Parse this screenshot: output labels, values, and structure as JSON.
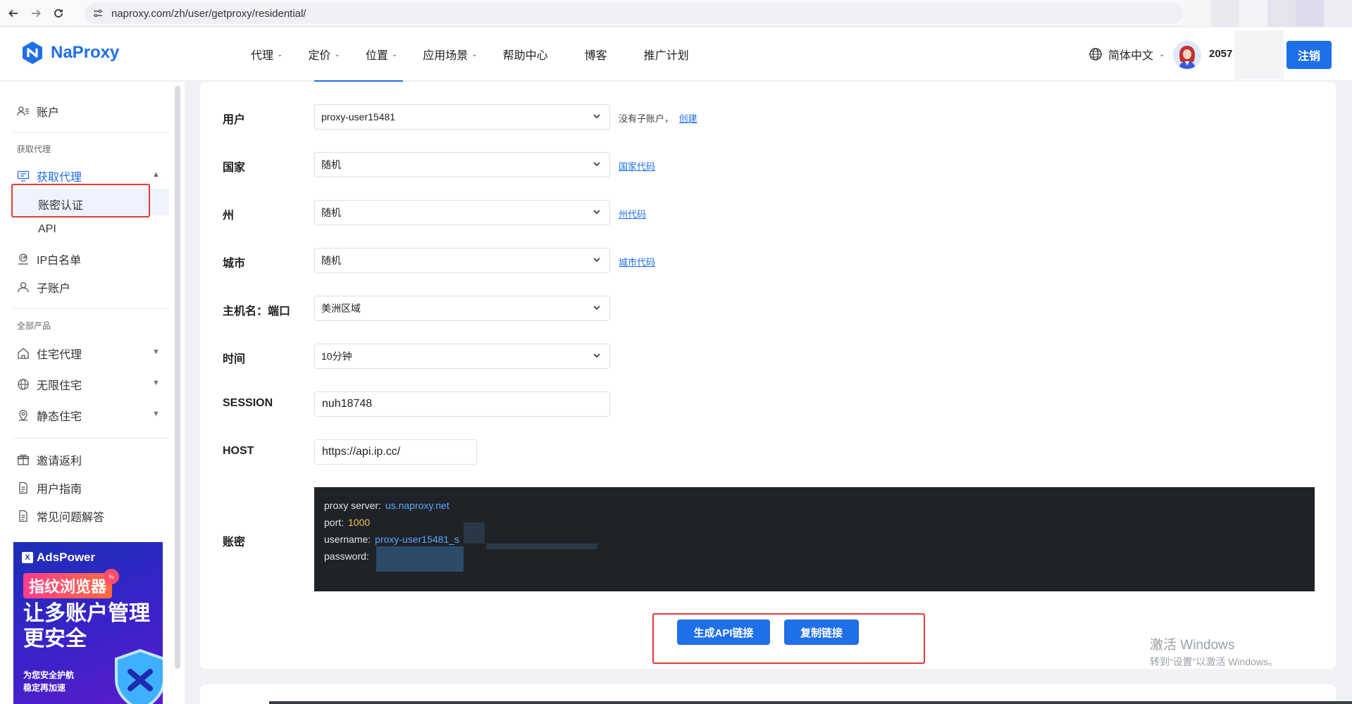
{
  "browser": {
    "url": "naproxy.com/zh/user/getproxy/residential/"
  },
  "header": {
    "brand": "NaProxy",
    "nav": [
      {
        "label": "代理",
        "dropdown": true
      },
      {
        "label": "定价",
        "dropdown": true
      },
      {
        "label": "位置",
        "dropdown": true
      },
      {
        "label": "应用场景",
        "dropdown": true
      },
      {
        "label": "帮助中心",
        "dropdown": false
      },
      {
        "label": "博客",
        "dropdown": false
      },
      {
        "label": "推广计划",
        "dropdown": false
      }
    ],
    "language": "简体中文",
    "user_id_partial": "2057",
    "logout_label": "注销",
    "accent_color": "#1f6fe8"
  },
  "sidebar": {
    "account": "账户",
    "section_get_proxy": "获取代理",
    "get_proxy": "获取代理",
    "account_auth": "账密认证",
    "api": "API",
    "ip_whitelist": "IP白名单",
    "sub_account": "子账户",
    "section_all_products": "全部产品",
    "residential": "住宅代理",
    "unlimited": "无限住宅",
    "static": "静态住宅",
    "invite": "邀请返利",
    "guide": "用户指南",
    "faq": "常见问题解答",
    "ad": {
      "brand": "AdsPower",
      "tag": "指纹浏览器",
      "headline_1": "让多账户管理",
      "headline_2": "更安全",
      "sub_1": "为您安全护航",
      "sub_2": "稳定再加速"
    }
  },
  "form": {
    "user": {
      "label": "用户",
      "value": "proxy-user15481",
      "note": "没有子账户，",
      "link": "创建"
    },
    "country": {
      "label": "国家",
      "value": "随机",
      "link": "国家代码"
    },
    "state": {
      "label": "州",
      "value": "随机",
      "link": "州代码"
    },
    "city": {
      "label": "城市",
      "value": "随机",
      "link": "城市代码"
    },
    "host_port": {
      "label": "主机名：端口",
      "value": "美洲区域"
    },
    "time": {
      "label": "时间",
      "value": "10分钟"
    },
    "session": {
      "label": "SESSION",
      "value": "nuh18748"
    },
    "host": {
      "label": "HOST",
      "value": "https://api.ip.cc/"
    },
    "credentials": {
      "label": "账密",
      "proxy_server_key": "proxy server:",
      "proxy_server_val": "us.naproxy.net",
      "port_key": "port:",
      "port_val": "1000",
      "username_key": "username:",
      "username_val": "proxy-user15481_s",
      "password_key": "password:"
    },
    "generate_api_label": "生成API链接",
    "copy_link_label": "复制链接"
  },
  "watermark": {
    "line1": "激活 Windows",
    "line2": "转到“设置”以激活 Windows。"
  }
}
